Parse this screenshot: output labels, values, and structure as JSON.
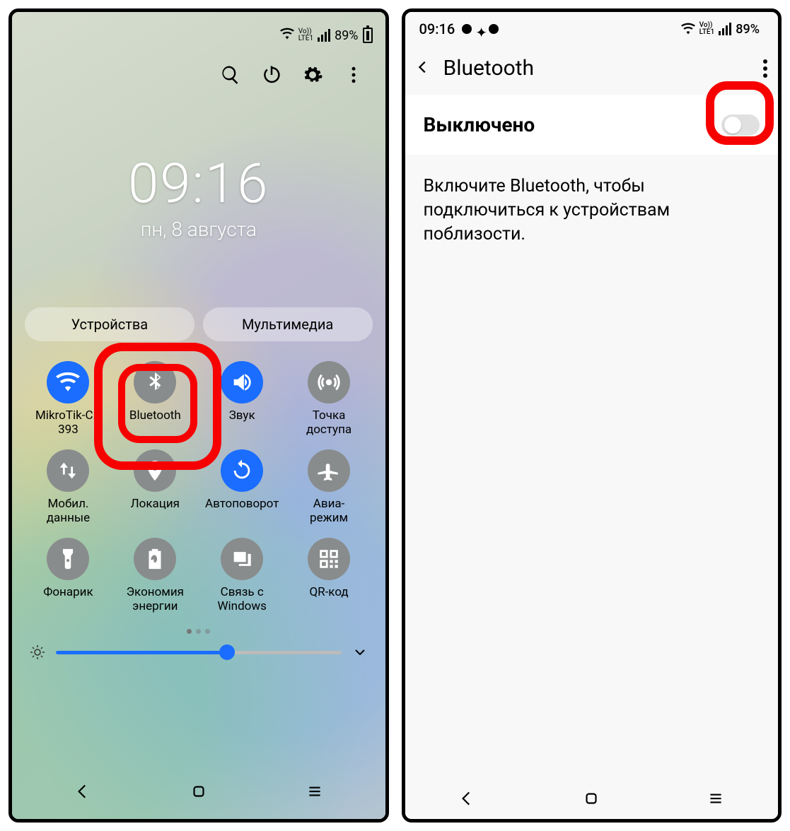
{
  "left": {
    "status": {
      "battery": "89%",
      "lte": "Vo))\nLTE1"
    },
    "clock": {
      "time": "09:16",
      "date": "пн, 8 августа"
    },
    "pills": {
      "devices": "Устройства",
      "media": "Мультимедиа"
    },
    "tiles": [
      {
        "label": "MikroTik-C…\n393",
        "icon": "wifi",
        "state": "on"
      },
      {
        "label": "Bluetooth",
        "icon": "bluetooth",
        "state": "off"
      },
      {
        "label": "Звук",
        "icon": "sound",
        "state": "on"
      },
      {
        "label": "Точка\nдоступа",
        "icon": "hotspot",
        "state": "off"
      },
      {
        "label": "Мобил.\nданные",
        "icon": "data",
        "state": "off"
      },
      {
        "label": "Локация",
        "icon": "location",
        "state": "off"
      },
      {
        "label": "Автоповорот",
        "icon": "rotate",
        "state": "on"
      },
      {
        "label": "Авиа-\nрежим",
        "icon": "airplane",
        "state": "off"
      },
      {
        "label": "Фонарик",
        "icon": "flashlight",
        "state": "off"
      },
      {
        "label": "Экономия\nэнергии",
        "icon": "battery-saver",
        "state": "off"
      },
      {
        "label": "Связь с\nWindows",
        "icon": "link-windows",
        "state": "off"
      },
      {
        "label": "QR-код",
        "icon": "qr",
        "state": "off"
      }
    ],
    "slider": {
      "brightness_pct": 60
    }
  },
  "right": {
    "status": {
      "time": "09:16",
      "battery": "89%"
    },
    "header": {
      "title": "Bluetooth"
    },
    "toggle": {
      "label": "Выключено",
      "on": false
    },
    "hint": "Включите Bluetooth, чтобы подключиться к устройствам поблизости."
  }
}
